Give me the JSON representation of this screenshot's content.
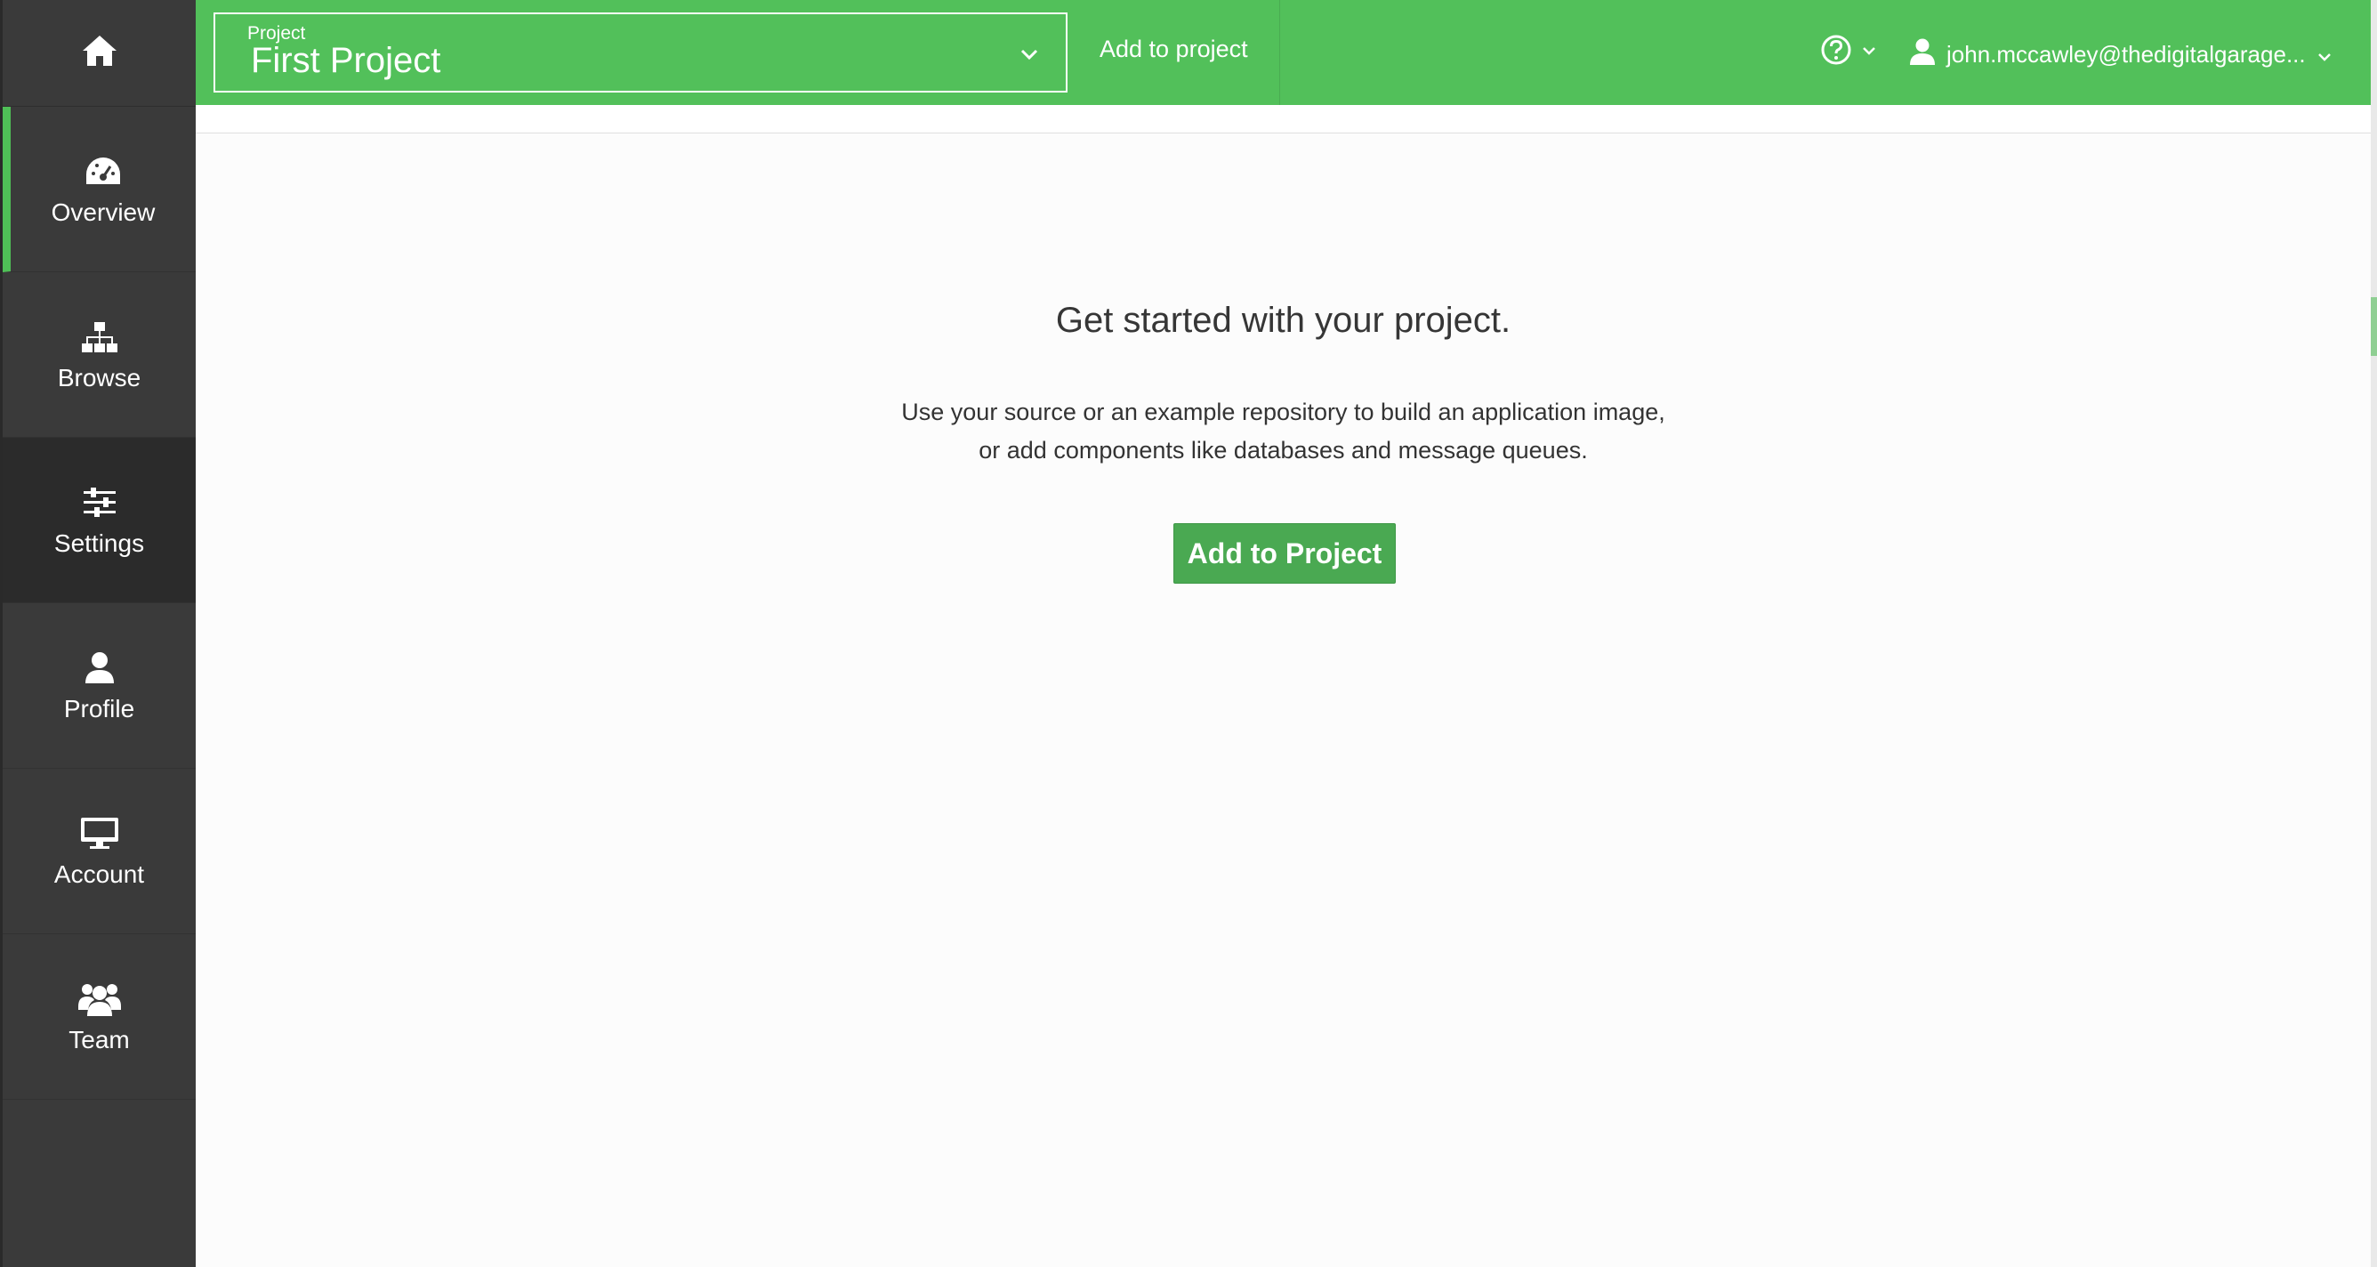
{
  "colors": {
    "brand_green": "#52c05a",
    "sidebar_bg": "#3a3a3a",
    "button_green": "#4aa952"
  },
  "sidebar": {
    "home_icon": "home-icon",
    "items": [
      {
        "label": "Overview",
        "icon": "dashboard-icon"
      },
      {
        "label": "Browse",
        "icon": "sitemap-icon"
      },
      {
        "label": "Settings",
        "icon": "sliders-icon"
      },
      {
        "label": "Profile",
        "icon": "user-icon"
      },
      {
        "label": "Account",
        "icon": "monitor-icon"
      },
      {
        "label": "Team",
        "icon": "users-icon"
      }
    ]
  },
  "header": {
    "project_caption": "Project",
    "project_name": "First Project",
    "add_to_project_link": "Add to project",
    "help_icon": "question-circle-icon",
    "user_email": "john.mccawley@thedigitalgarage..."
  },
  "main": {
    "headline": "Get started with your project.",
    "description_line1": "Use your source or an example repository to build an application image,",
    "description_line2": "or add components like databases and message queues.",
    "cta_label": "Add to Project"
  }
}
